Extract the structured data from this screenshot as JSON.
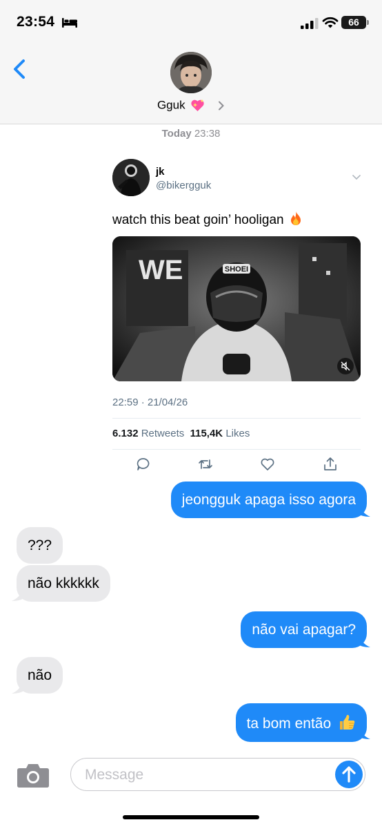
{
  "status_bar": {
    "time": "23:54",
    "battery": "66"
  },
  "header": {
    "contact_name": "Gguk"
  },
  "conversation": {
    "timestamp_day": "Today",
    "timestamp_time": "23:38"
  },
  "tweet": {
    "display_name": "jk",
    "handle": "@bikergguk",
    "text": "watch this beat goin’ hooligan",
    "datetime": "22:59 · 21/04/26",
    "retweets_count": "6.132",
    "retweets_label": "Retweets",
    "likes_count": "115,4K",
    "likes_label": "Likes",
    "media_sign_text": "WE",
    "media_helmet_text": "SHOEI"
  },
  "messages": [
    {
      "direction": "sent",
      "text": "jeongguk apaga isso agora"
    },
    {
      "direction": "received",
      "text": "???"
    },
    {
      "direction": "received",
      "text": "não kkkkkk"
    },
    {
      "direction": "sent",
      "text": "não vai apagar?"
    },
    {
      "direction": "received",
      "text": "não"
    },
    {
      "direction": "sent",
      "text": "ta bom então"
    }
  ],
  "composer": {
    "placeholder": "Message"
  },
  "colors": {
    "accent": "#1f8af8",
    "received_bubble": "#e9e9eb",
    "secondary_text": "#8e8e93",
    "tweet_secondary_text": "#5b7083"
  }
}
